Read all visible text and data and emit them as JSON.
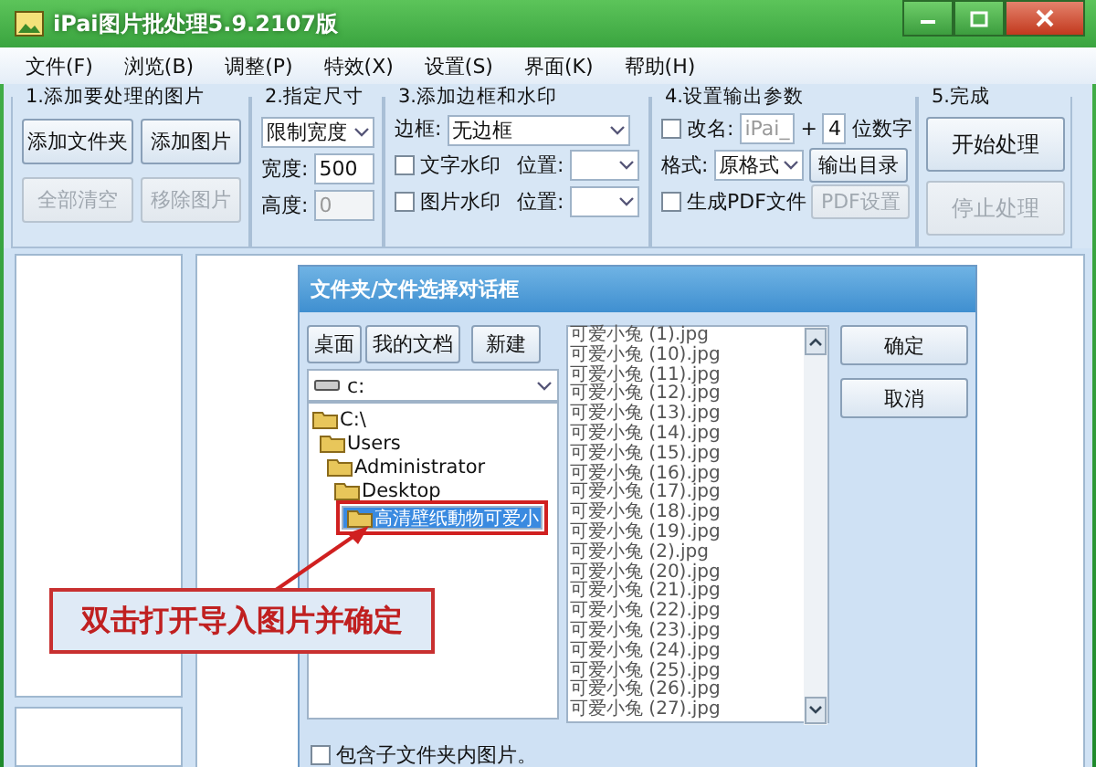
{
  "window": {
    "title": "iPai图片批处理5.9.2107版"
  },
  "menu": [
    "文件(F)",
    "浏览(B)",
    "调整(P)",
    "特效(X)",
    "设置(S)",
    "界面(K)",
    "帮助(H)"
  ],
  "step1": {
    "title": "1.添加要处理的图片",
    "buttons": [
      {
        "label": "添加文件夹",
        "disabled": false
      },
      {
        "label": "添加图片",
        "disabled": false
      },
      {
        "label": "全部清空",
        "disabled": true
      },
      {
        "label": "移除图片",
        "disabled": true
      }
    ]
  },
  "step2": {
    "title": "2.指定尺寸",
    "mode": "限制宽度",
    "width_label": "宽度:",
    "width_value": "500",
    "height_label": "高度:",
    "height_value": "0",
    "height_disabled": true
  },
  "step3": {
    "title": "3.添加边框和水印",
    "border_label": "边框:",
    "border_value": "无边框",
    "watermarks": [
      {
        "label": "文字水印",
        "checked": false,
        "position_label": "位置:"
      },
      {
        "label": "图片水印",
        "checked": false,
        "position_label": "位置:"
      }
    ]
  },
  "step4": {
    "title": "4.设置输出参数",
    "rename_label": "改名:",
    "rename_checked": false,
    "prefix": "iPai_",
    "plus": "+",
    "digits": "4",
    "digits_label": "位数字",
    "format_label": "格式:",
    "format_value": "原格式",
    "output_button": "输出目录",
    "pdf_label": "生成PDF文件",
    "pdf_checked": false,
    "pdf_settings": {
      "label": "PDF设置",
      "disabled": true
    }
  },
  "step5": {
    "title": "5.完成",
    "buttons": [
      {
        "label": "开始处理",
        "disabled": false
      },
      {
        "label": "停止处理",
        "disabled": true
      }
    ]
  },
  "dialog": {
    "title": "文件夹/文件选择对话框",
    "buttons": [
      "桌面",
      "我的文档",
      "新建"
    ],
    "drive": "c:",
    "tree": [
      {
        "label": "C:\\",
        "selected": false,
        "children": [
          {
            "label": "Users",
            "selected": false,
            "children": [
              {
                "label": "Administrator",
                "selected": false,
                "children": [
                  {
                    "label": "Desktop",
                    "selected": false,
                    "children": [
                      {
                        "label": "高清壁纸動物可爱小",
                        "selected": true
                      }
                    ]
                  }
                ]
              }
            ]
          }
        ]
      }
    ],
    "files": [
      "可爱小兔 (1).jpg",
      "可爱小兔 (10).jpg",
      "可爱小兔 (11).jpg",
      "可爱小兔 (12).jpg",
      "可爱小兔 (13).jpg",
      "可爱小兔 (14).jpg",
      "可爱小兔 (15).jpg",
      "可爱小兔 (16).jpg",
      "可爱小兔 (17).jpg",
      "可爱小兔 (18).jpg",
      "可爱小兔 (19).jpg",
      "可爱小兔 (2).jpg",
      "可爱小兔 (20).jpg",
      "可爱小兔 (21).jpg",
      "可爱小兔 (22).jpg",
      "可爱小兔 (23).jpg",
      "可爱小兔 (24).jpg",
      "可爱小兔 (25).jpg",
      "可爱小兔 (26).jpg",
      "可爱小兔 (27).jpg"
    ],
    "ok": "确定",
    "cancel": "取消",
    "subfolders_label": "包含子文件夹内图片。",
    "subfolders_checked": false
  },
  "callout": {
    "text": "双击打开导入图片并确定"
  }
}
